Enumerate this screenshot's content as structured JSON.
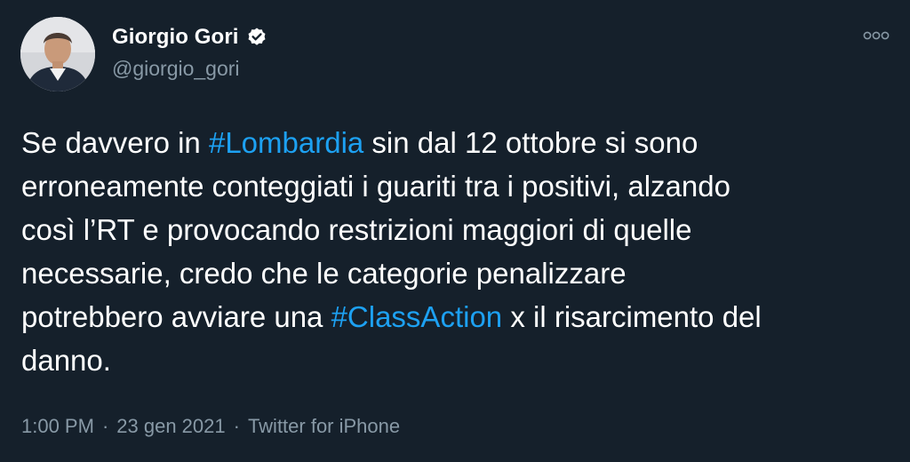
{
  "author": {
    "display_name": "Giorgio Gori",
    "handle": "@giorgio_gori",
    "verified": true
  },
  "icons": {
    "verified": "verified-badge-icon",
    "more": "more-options-icon",
    "avatar": "profile-photo"
  },
  "tweet": {
    "lines": [
      [
        {
          "text": "Se davvero in ",
          "type": "text"
        },
        {
          "text": "#Lombardia",
          "type": "hashtag"
        },
        {
          "text": " sin dal 12 ottobre si sono",
          "type": "text"
        }
      ],
      [
        {
          "text": "erroneamente conteggiati i guariti tra i positivi, alzando",
          "type": "text"
        }
      ],
      [
        {
          "text": "così l’RT e provocando restrizioni maggiori di quelle",
          "type": "text"
        }
      ],
      [
        {
          "text": "necessarie, credo che le categorie penalizzare",
          "type": "text"
        }
      ],
      [
        {
          "text": "potrebbero avviare una ",
          "type": "text"
        },
        {
          "text": "#ClassAction",
          "type": "hashtag"
        },
        {
          "text": " x il risarcimento del",
          "type": "text"
        }
      ],
      [
        {
          "text": "danno.",
          "type": "text"
        }
      ]
    ]
  },
  "meta": {
    "time": "1:00 PM",
    "separator": "·",
    "date": "23 gen 2021",
    "source": "Twitter for iPhone"
  },
  "colors": {
    "background": "#15202b",
    "text": "#ffffff",
    "secondary": "#8899a6",
    "link": "#1da1f2"
  }
}
